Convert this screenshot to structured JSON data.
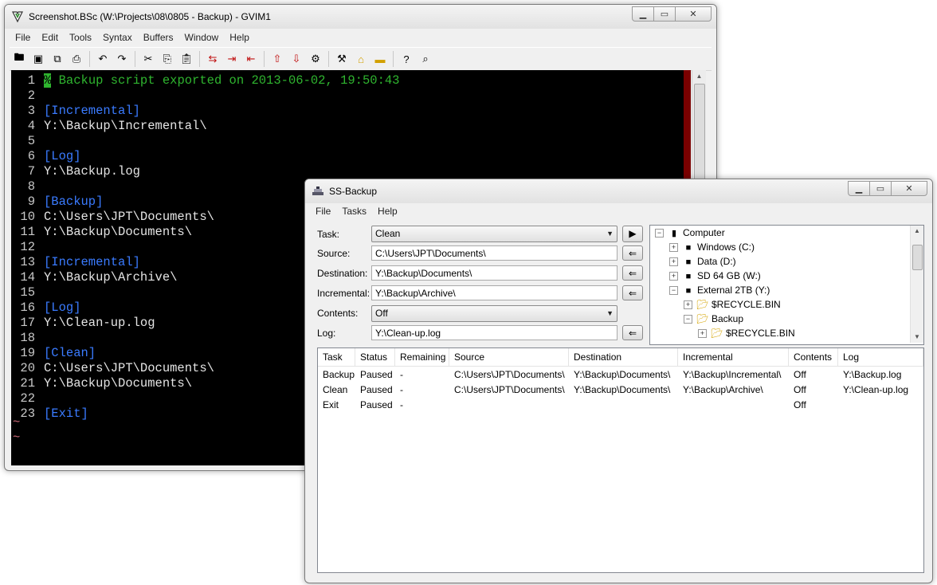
{
  "gvim": {
    "title": "Screenshot.BSc (W:\\Projects\\08\\0805 - Backup) - GVIM1",
    "menu": [
      "File",
      "Edit",
      "Tools",
      "Syntax",
      "Buffers",
      "Window",
      "Help"
    ],
    "lines": [
      {
        "n": "1",
        "text": "% Backup script exported on 2013-06-02, 19:50:43",
        "type": "comment"
      },
      {
        "n": "2",
        "text": "",
        "type": "normal"
      },
      {
        "n": "3",
        "text": "[Incremental]",
        "type": "section"
      },
      {
        "n": "4",
        "text": "Y:\\Backup\\Incremental\\",
        "type": "normal"
      },
      {
        "n": "5",
        "text": "",
        "type": "normal"
      },
      {
        "n": "6",
        "text": "[Log]",
        "type": "section"
      },
      {
        "n": "7",
        "text": "Y:\\Backup.log",
        "type": "normal"
      },
      {
        "n": "8",
        "text": "",
        "type": "normal"
      },
      {
        "n": "9",
        "text": "[Backup]",
        "type": "section"
      },
      {
        "n": "10",
        "text": "C:\\Users\\JPT\\Documents\\",
        "type": "normal"
      },
      {
        "n": "11",
        "text": "Y:\\Backup\\Documents\\",
        "type": "normal"
      },
      {
        "n": "12",
        "text": "",
        "type": "normal"
      },
      {
        "n": "13",
        "text": "[Incremental]",
        "type": "section"
      },
      {
        "n": "14",
        "text": "Y:\\Backup\\Archive\\",
        "type": "normal"
      },
      {
        "n": "15",
        "text": "",
        "type": "normal"
      },
      {
        "n": "16",
        "text": "[Log]",
        "type": "section"
      },
      {
        "n": "17",
        "text": "Y:\\Clean-up.log",
        "type": "normal"
      },
      {
        "n": "18",
        "text": "",
        "type": "normal"
      },
      {
        "n": "19",
        "text": "[Clean]",
        "type": "section"
      },
      {
        "n": "20",
        "text": "C:\\Users\\JPT\\Documents\\",
        "type": "normal"
      },
      {
        "n": "21",
        "text": "Y:\\Backup\\Documents\\",
        "type": "normal"
      },
      {
        "n": "22",
        "text": "",
        "type": "normal"
      },
      {
        "n": "23",
        "text": "[Exit]",
        "type": "section"
      }
    ],
    "tildes": [
      "~",
      "~"
    ],
    "colors": {
      "comment": "#2fb52f",
      "section": "#3a7bff",
      "normal": "#e4e4e4",
      "background": "#000000"
    }
  },
  "ssbackup": {
    "title": "SS-Backup",
    "menu": [
      "File",
      "Tasks",
      "Help"
    ],
    "form": {
      "task_label": "Task:",
      "task_value": "Clean",
      "source_label": "Source:",
      "source_value": "C:\\Users\\JPT\\Documents\\",
      "destination_label": "Destination:",
      "destination_value": "Y:\\Backup\\Documents\\",
      "incremental_label": "Incremental:",
      "incremental_value": "Y:\\Backup\\Archive\\",
      "contents_label": "Contents:",
      "contents_value": "Off",
      "log_label": "Log:",
      "log_value": "Y:\\Clean-up.log"
    },
    "tree": [
      {
        "label": "Computer",
        "level": 0,
        "expander": "−",
        "icon": "computer-icon"
      },
      {
        "label": "Windows (C:)",
        "level": 1,
        "expander": "+",
        "icon": "drive-icon"
      },
      {
        "label": "Data (D:)",
        "level": 1,
        "expander": "+",
        "icon": "drive-icon"
      },
      {
        "label": "SD 64 GB (W:)",
        "level": 1,
        "expander": "+",
        "icon": "drive-icon"
      },
      {
        "label": "External 2TB (Y:)",
        "level": 1,
        "expander": "−",
        "icon": "drive-icon"
      },
      {
        "label": "$RECYCLE.BIN",
        "level": 2,
        "expander": "+",
        "icon": "folder-icon"
      },
      {
        "label": "Backup",
        "level": 2,
        "expander": "−",
        "icon": "folder-icon"
      },
      {
        "label": "$RECYCLE.BIN",
        "level": 3,
        "expander": "+",
        "icon": "folder-icon"
      }
    ],
    "columns": [
      "Task",
      "Status",
      "Remaining",
      "Source",
      "Destination",
      "Incremental",
      "Contents",
      "Log"
    ],
    "rows": [
      [
        "Backup",
        "Paused",
        "-",
        "C:\\Users\\JPT\\Documents\\",
        "Y:\\Backup\\Documents\\",
        "Y:\\Backup\\Incremental\\",
        "Off",
        "Y:\\Backup.log"
      ],
      [
        "Clean",
        "Paused",
        "-",
        "C:\\Users\\JPT\\Documents\\",
        "Y:\\Backup\\Documents\\",
        "Y:\\Backup\\Archive\\",
        "Off",
        "Y:\\Clean-up.log"
      ],
      [
        "Exit",
        "Paused",
        "-",
        "",
        "",
        "",
        "Off",
        ""
      ]
    ]
  }
}
